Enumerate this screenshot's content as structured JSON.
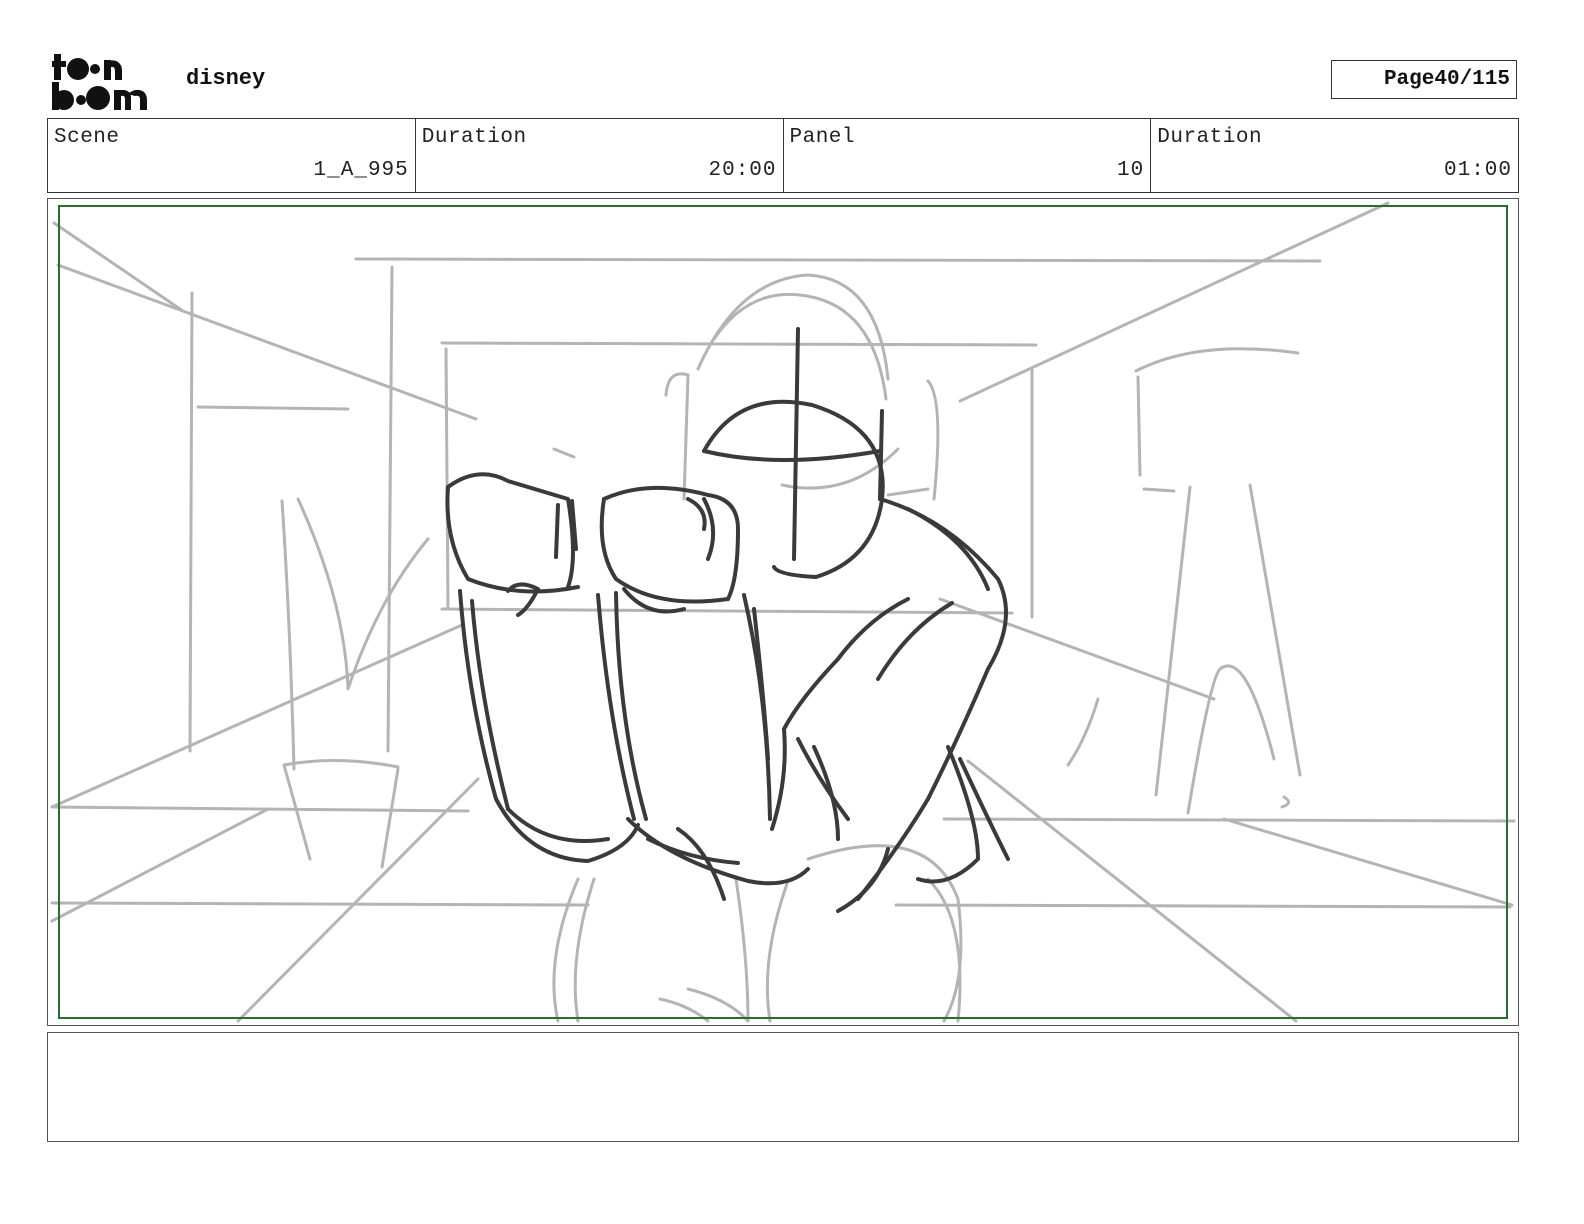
{
  "header": {
    "logo_text": "toon boom",
    "project": "disney",
    "page_label": "Page",
    "page_value": "40/115"
  },
  "info": {
    "scene_label": "Scene",
    "scene_value": "1_A_995",
    "scene_duration_label": "Duration",
    "scene_duration_value": "20:00",
    "panel_label": "Panel",
    "panel_value": "10",
    "panel_duration_label": "Duration",
    "panel_duration_value": "01:00"
  },
  "colors": {
    "safe_frame": "#2e6b2e",
    "sketch_light": "#b4b4b4",
    "sketch_dark": "#3a3a3a"
  },
  "notes": {
    "text": ""
  }
}
